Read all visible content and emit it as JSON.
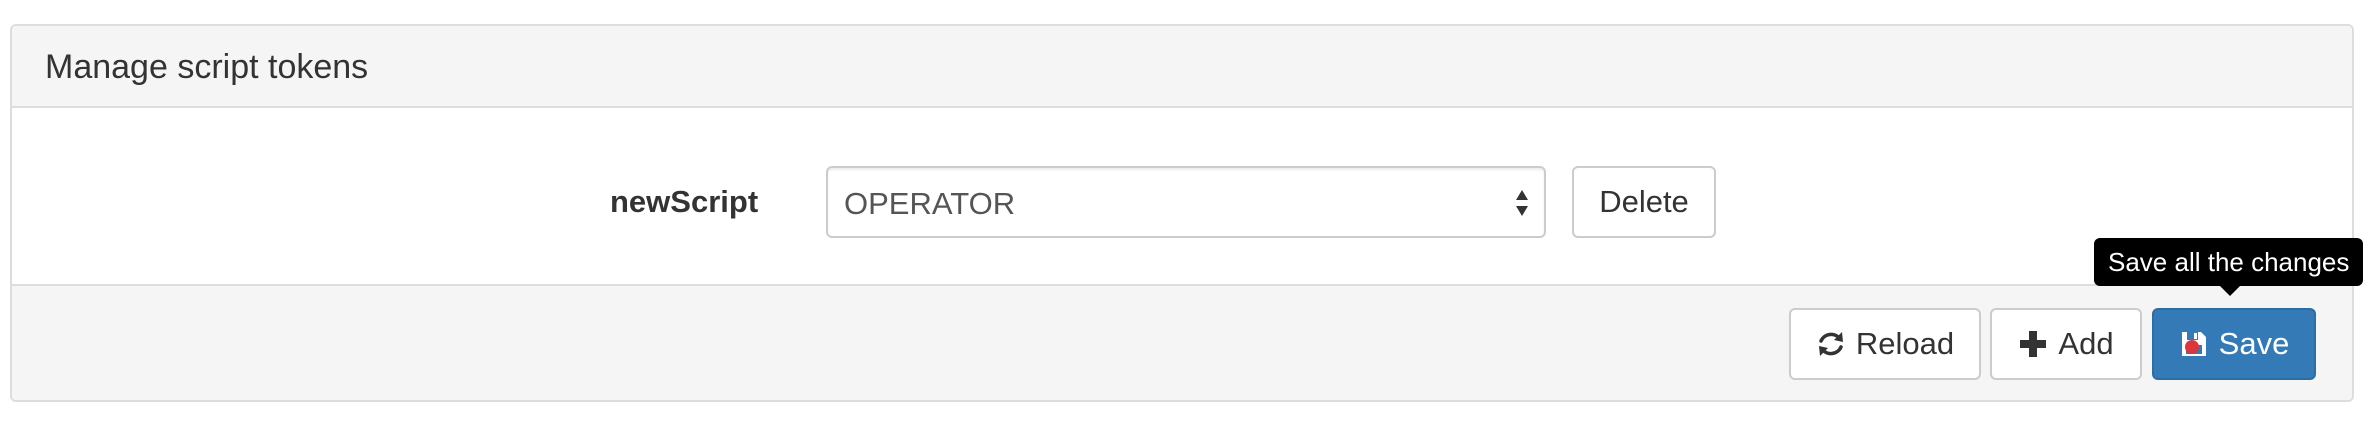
{
  "panel": {
    "title": "Manage script tokens"
  },
  "token": {
    "label": "newScript",
    "selected_value": "OPERATOR",
    "delete_label": "Delete"
  },
  "footer": {
    "reload_label": "Reload",
    "add_label": "Add",
    "save_label": "Save",
    "save_tooltip": "Save all the changes"
  },
  "icons": {
    "reload": "refresh-icon",
    "add": "plus-icon",
    "save": "floppy-disk-icon",
    "select": "select-arrows-icon"
  },
  "colors": {
    "primary": "#337ab7",
    "panel_bg": "#f5f5f5",
    "border": "#dddddd"
  }
}
